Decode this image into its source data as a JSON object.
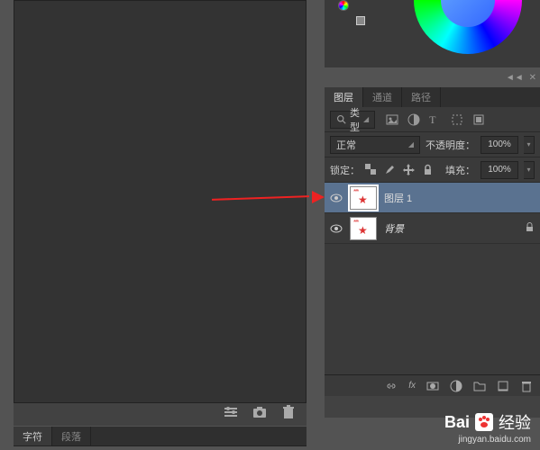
{
  "canvas": {},
  "bottombar": {},
  "char_panel": {
    "tabs": [
      "字符",
      "段落"
    ]
  },
  "panel_collapse": {
    "sym1": "◄◄",
    "sym2": "✕"
  },
  "layers_panel": {
    "tabs": [
      "图层",
      "通道",
      "路径"
    ],
    "filter": {
      "kind_label": "类型"
    },
    "blend": {
      "mode": "正常",
      "opacity_label": "不透明度：",
      "opacity_value": "100%"
    },
    "lock": {
      "label": "锁定：",
      "fill_label": "填充：",
      "fill_value": "100%"
    },
    "layers": [
      {
        "name": "图层 1",
        "selected": true,
        "locked": false
      },
      {
        "name": "背景",
        "selected": false,
        "locked": true
      }
    ]
  },
  "watermark": {
    "brand1": "Bai",
    "brand2": "经验",
    "url": "jingyan.baidu.com"
  }
}
